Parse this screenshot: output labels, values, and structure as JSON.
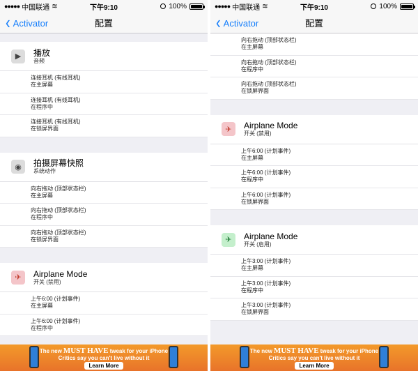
{
  "status": {
    "carrier": "中国联通",
    "time": "下午9:10",
    "battery": "100%"
  },
  "nav": {
    "back_label": "Activator",
    "title": "配置"
  },
  "left": {
    "section1": {
      "title": "播放",
      "subtitle": "音频",
      "rows": [
        {
          "l1": "连接耳机 (有线耳机)",
          "l2": "在主屏幕"
        },
        {
          "l1": "连接耳机 (有线耳机)",
          "l2": "在程序中"
        },
        {
          "l1": "连接耳机 (有线耳机)",
          "l2": "在锁屏界面"
        }
      ]
    },
    "section2": {
      "title": "拍摄屏幕快照",
      "subtitle": "系统动作",
      "rows": [
        {
          "l1": "向右拖动 (顶部状态栏)",
          "l2": "在主屏幕"
        },
        {
          "l1": "向右拖动 (顶部状态栏)",
          "l2": "在程序中"
        },
        {
          "l1": "向右拖动 (顶部状态栏)",
          "l2": "在锁屏界面"
        }
      ]
    },
    "section3": {
      "title": "Airplane Mode",
      "subtitle": "开关 (禁用)",
      "rows": [
        {
          "l1": "上午6:00 (计划事件)",
          "l2": "在主屏幕"
        },
        {
          "l1": "上午6:00 (计划事件)",
          "l2": "在程序中"
        }
      ]
    }
  },
  "right": {
    "top_rows": [
      {
        "l1": "向右拖动 (顶部状态栏)",
        "l2": "在主屏幕"
      },
      {
        "l1": "向右拖动 (顶部状态栏)",
        "l2": "在程序中"
      },
      {
        "l1": "向右拖动 (顶部状态栏)",
        "l2": "在锁屏界面"
      }
    ],
    "section1": {
      "title": "Airplane Mode",
      "subtitle": "开关 (禁用)",
      "rows": [
        {
          "l1": "上午6:00 (计划事件)",
          "l2": "在主屏幕"
        },
        {
          "l1": "上午6:00 (计划事件)",
          "l2": "在程序中"
        },
        {
          "l1": "上午6:00 (计划事件)",
          "l2": "在锁屏界面"
        }
      ]
    },
    "section2": {
      "title": "Airplane Mode",
      "subtitle": "开关 (启用)",
      "rows": [
        {
          "l1": "上午3:00 (计划事件)",
          "l2": "在主屏幕"
        },
        {
          "l1": "上午3:00 (计划事件)",
          "l2": "在程序中"
        },
        {
          "l1": "上午3:00 (计划事件)",
          "l2": "在锁屏界面"
        }
      ]
    }
  },
  "ad": {
    "line1_pre": "The new",
    "line1_must": "MUST HAVE",
    "line1_post": "tweak for your iPhone",
    "line2": "Critics say you can't live without it",
    "button": "Learn More"
  },
  "icons": {
    "play": "play-icon",
    "eye": "eye-icon",
    "airplane": "airplane-icon"
  },
  "colors": {
    "accent": "#157efb",
    "airplane_disabled_bg": "#f4c5c9",
    "airplane_enabled_bg": "#c4efcc",
    "ad_bg": "#f39a2a"
  }
}
